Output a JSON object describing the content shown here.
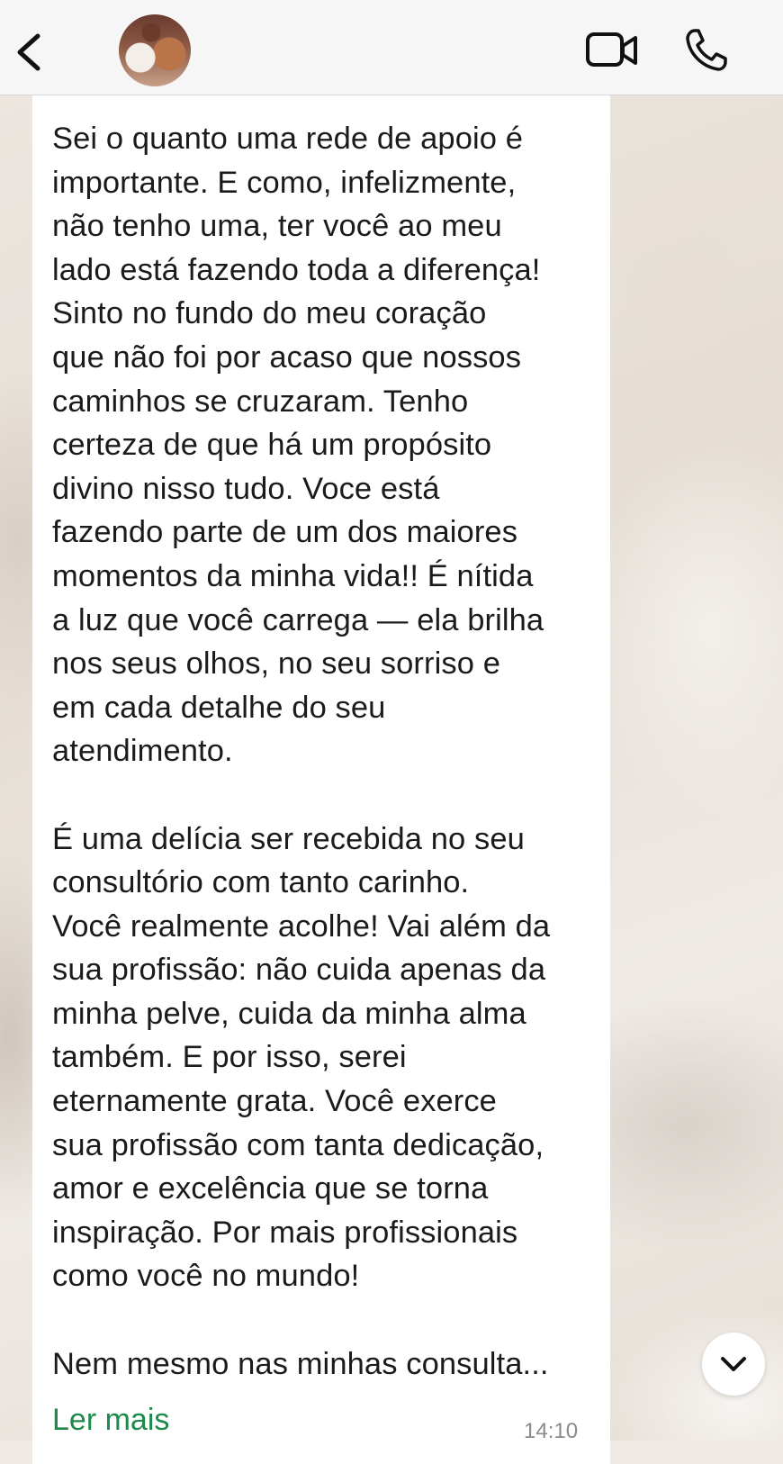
{
  "header": {
    "back_icon": "chevron-left-icon",
    "avatar_icon": "contact-avatar",
    "video_icon": "video-camera-icon",
    "call_icon": "phone-icon"
  },
  "message": {
    "text": "Sei o quanto uma rede de apoio é\nimportante. E como, infelizmente,\nnão tenho uma, ter você ao meu\nlado está fazendo toda a diferença!\nSinto no fundo do meu coração\nque não foi por acaso que nossos\ncaminhos se cruzaram. Tenho\ncerteza de que há um propósito\ndivino nisso tudo. Voce está\nfazendo parte de um dos maiores\nmomentos da minha vida!! É nítida\na luz que você carrega — ela brilha\nnos seus olhos, no seu sorriso e\nem cada detalhe do seu\natendimento.\n\nÉ uma delícia ser recebida no seu\nconsultório com tanto carinho.\nVocê realmente acolhe! Vai além da\nsua profissão: não cuida apenas da\nminha pelve, cuida da minha alma\ntambém. E por isso, serei\neternamente grata. Você exerce\nsua profissão com tanta dedicação,\namor e excelência que se torna\ninspiração. Por mais profissionais\ncomo você no mundo!\n\nNem mesmo nas minhas consulta...",
    "read_more_label": "Ler mais",
    "time": "14:10"
  },
  "scroll_button": {
    "icon": "chevron-down-icon"
  },
  "colors": {
    "header_bg": "#f6f6f6",
    "bubble_bg": "#ffffff",
    "link_green": "#1d8a4c",
    "text": "#1b1b1b",
    "timestamp": "#8a8a8a"
  }
}
